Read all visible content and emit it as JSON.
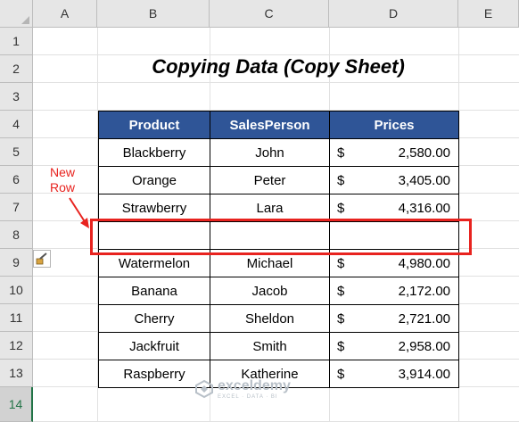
{
  "columns": [
    "A",
    "B",
    "C",
    "D",
    "E"
  ],
  "rows": [
    "1",
    "2",
    "3",
    "4",
    "5",
    "6",
    "7",
    "8",
    "9",
    "10",
    "11",
    "12",
    "13",
    "14"
  ],
  "active_row": "14",
  "title": "Copying Data (Copy Sheet)",
  "table": {
    "headers": [
      "Product",
      "SalesPerson",
      "Prices"
    ],
    "rows": [
      {
        "product": "Blackberry",
        "person": "John",
        "currency": "$",
        "price": "2,580.00"
      },
      {
        "product": "Orange",
        "person": "Peter",
        "currency": "$",
        "price": "3,405.00"
      },
      {
        "product": "Strawberry",
        "person": "Lara",
        "currency": "$",
        "price": "4,316.00"
      },
      {
        "product": "",
        "person": "",
        "currency": "",
        "price": ""
      },
      {
        "product": "Watermelon",
        "person": "Michael",
        "currency": "$",
        "price": "4,980.00"
      },
      {
        "product": "Banana",
        "person": "Jacob",
        "currency": "$",
        "price": "2,172.00"
      },
      {
        "product": "Cherry",
        "person": "Sheldon",
        "currency": "$",
        "price": "2,721.00"
      },
      {
        "product": "Jackfruit",
        "person": "Smith",
        "currency": "$",
        "price": "2,958.00"
      },
      {
        "product": "Raspberry",
        "person": "Katherine",
        "currency": "$",
        "price": "3,914.00"
      }
    ]
  },
  "annotation": {
    "line1": "New",
    "line2": "Row"
  },
  "watermark": {
    "name": "exceldemy",
    "tagline": "EXCEL · DATA · BI"
  },
  "colors": {
    "header_fill": "#2f5597",
    "highlight": "#e8231f",
    "active_row": "#217346"
  }
}
